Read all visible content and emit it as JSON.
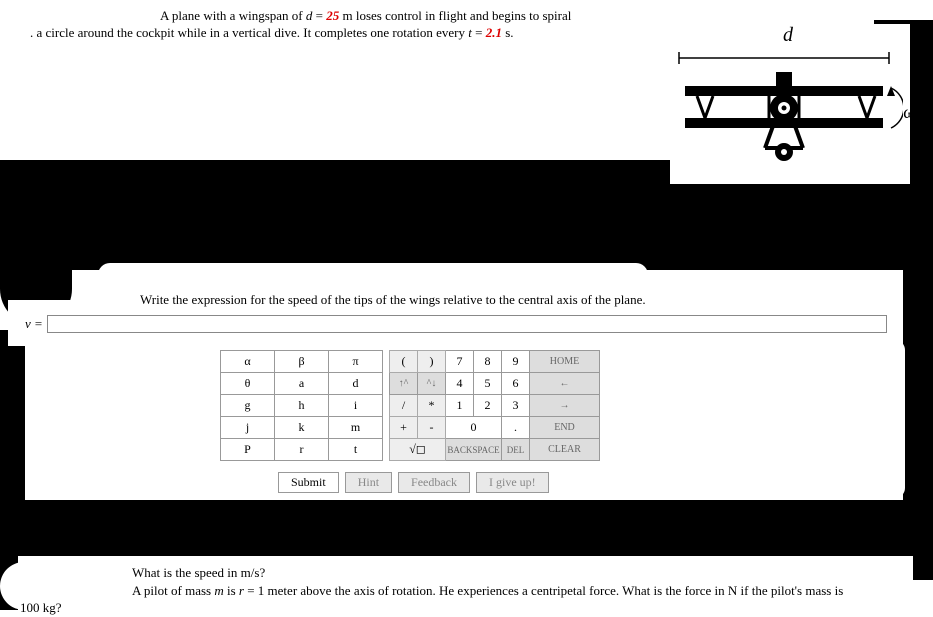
{
  "problem": {
    "line1_prefix": "A plane with a wingspan of ",
    "d_var": "d",
    "eq1": " = ",
    "d_value": "25",
    "d_unit": " m loses control in flight and begins to spiral",
    "line2_prefix": ". a circle around the cockpit while in a vertical dive. It completes one rotation every ",
    "t_var": "t",
    "eq2": " = ",
    "t_value": "2.1",
    "t_unit": " s."
  },
  "diagram": {
    "d_label": "d",
    "omega_label": "ω"
  },
  "instruction": "Write the expression for the speed of the tips of the wings relative to the central axis of the plane.",
  "input": {
    "label": "v =",
    "placeholder": ""
  },
  "keypad": {
    "symbols": [
      [
        "α",
        "β",
        "π"
      ],
      [
        "θ",
        "a",
        "d"
      ],
      [
        "g",
        "h",
        "i"
      ],
      [
        "j",
        "k",
        "m"
      ],
      [
        "P",
        "r",
        "t"
      ]
    ],
    "ops_col": [
      "(",
      "↑^",
      "/",
      "+",
      "√◻"
    ],
    "ops_col2": [
      ")",
      "^↓",
      "*",
      "-",
      "BACKSPACE"
    ],
    "nums": [
      [
        "7",
        "8",
        "9"
      ],
      [
        "4",
        "5",
        "6"
      ],
      [
        "1",
        "2",
        "3"
      ],
      [
        "0",
        "",
        ""
      ]
    ],
    "side": [
      "HOME",
      "←",
      "→",
      "END",
      "CLEAR"
    ],
    "zero": "0",
    "dot": ".",
    "backspace": "BACKSPACE",
    "del": "DEL"
  },
  "actions": {
    "submit": "Submit",
    "hint": "Hint",
    "feedback": "Feedback",
    "giveup": "I give up!"
  },
  "followup": {
    "q1": "What is the speed in m/s?",
    "q2_prefix": "A pilot of mass ",
    "m_var": "m",
    "q2_mid": " is ",
    "r_var": "r",
    "q2_eq": " = 1 meter above the axis of rotation. He experiences a centripetal force. What is the force in N if the pilot's mass is",
    "q2_end": "100 kg?"
  }
}
